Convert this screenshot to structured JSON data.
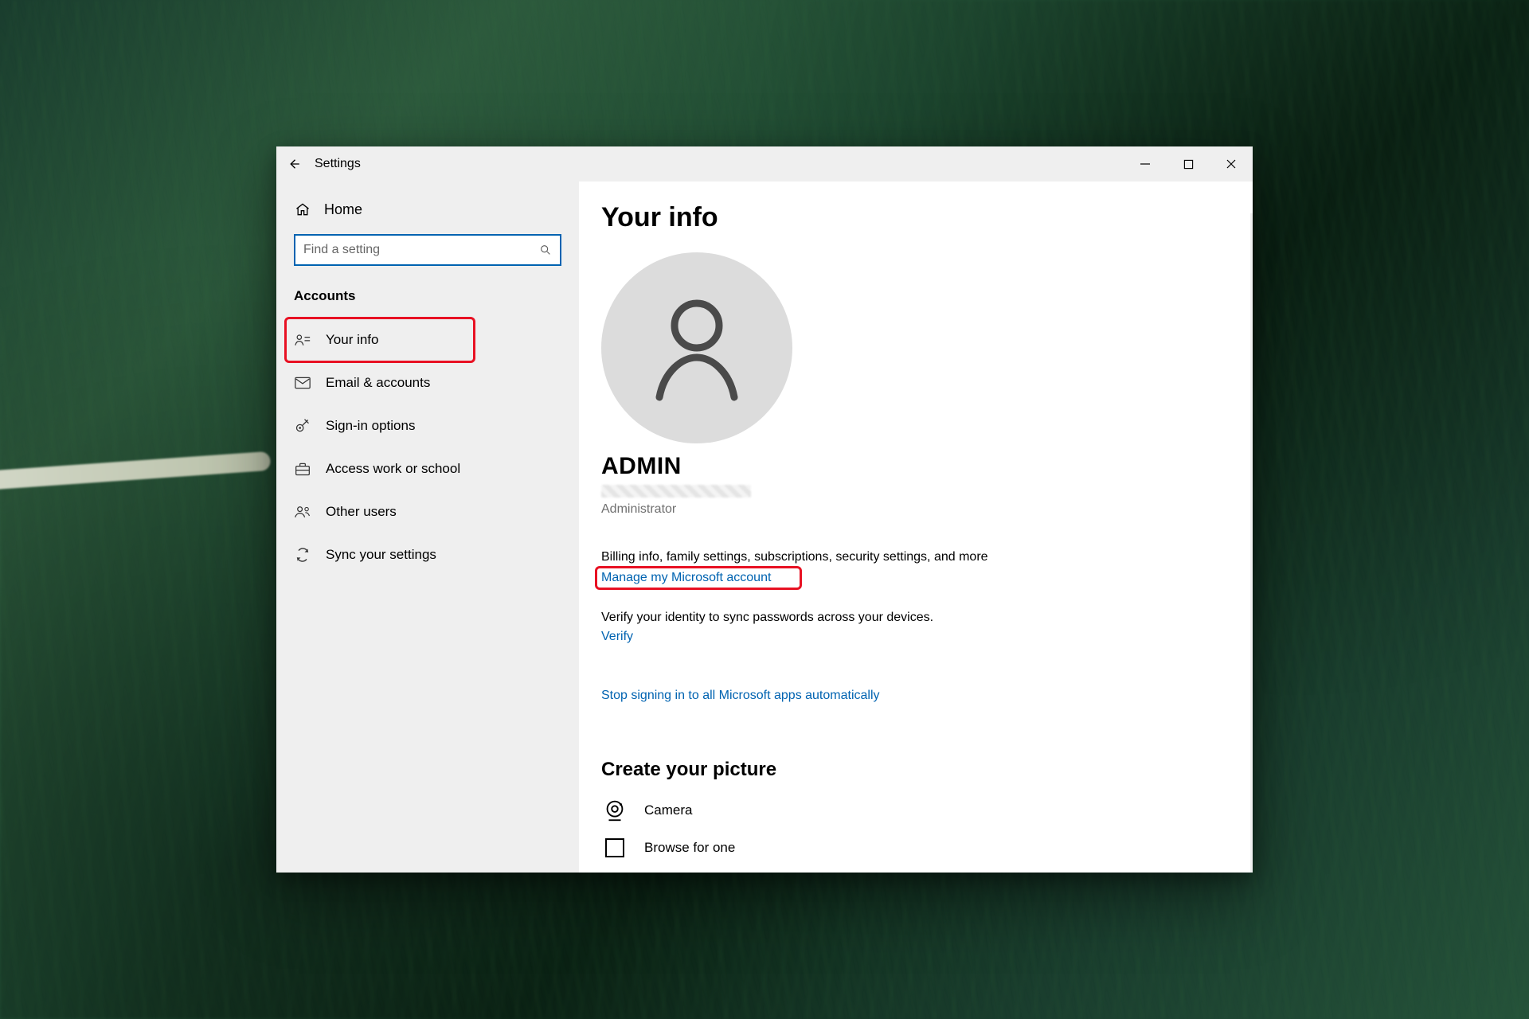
{
  "window": {
    "title": "Settings"
  },
  "sidebar": {
    "home": "Home",
    "search_placeholder": "Find a setting",
    "category": "Accounts",
    "items": [
      {
        "label": "Your info",
        "selected": true
      },
      {
        "label": "Email & accounts"
      },
      {
        "label": "Sign-in options"
      },
      {
        "label": "Access work or school"
      },
      {
        "label": "Other users"
      },
      {
        "label": "Sync your settings"
      }
    ]
  },
  "content": {
    "heading": "Your info",
    "username": "ADMIN",
    "role": "Administrator",
    "billing_line": "Billing info, family settings, subscriptions, security settings, and more",
    "manage_link": "Manage my Microsoft account",
    "verify_line": "Verify your identity to sync passwords across your devices.",
    "verify_link": "Verify",
    "stop_link": "Stop signing in to all Microsoft apps automatically",
    "picture_heading": "Create your picture",
    "camera_label": "Camera",
    "browse_label": "Browse for one"
  }
}
